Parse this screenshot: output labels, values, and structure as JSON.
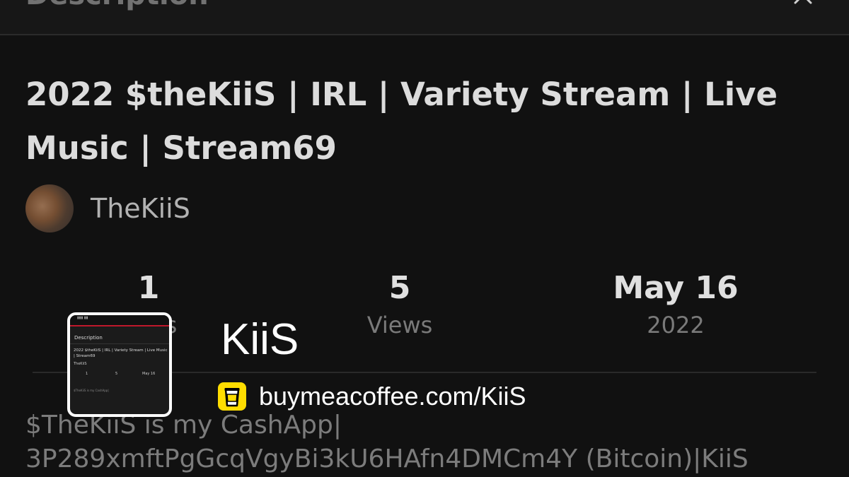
{
  "header": {
    "title": "Description"
  },
  "video": {
    "title": "2022 $theKiiS | IRL | Variety Stream | Live Music | Stream69"
  },
  "channel": {
    "name": "TheKiiS"
  },
  "stats": [
    {
      "value": "1",
      "label": "Likes"
    },
    {
      "value": "5",
      "label": "Views"
    },
    {
      "value": "May 16",
      "label": "2022"
    }
  ],
  "description": {
    "line1": "$TheKiiS is my CashApp|",
    "line2": "3P289xmftPgGcqVgyBi3kU6HAfn4DMCm4Y (Bitcoin)|KiiS"
  },
  "overlay": {
    "name": "KiiS",
    "link": "buymeacoffee.com/KiiS",
    "link_icon": "coffee-cup-icon",
    "brand_color": "#FFDD00"
  }
}
